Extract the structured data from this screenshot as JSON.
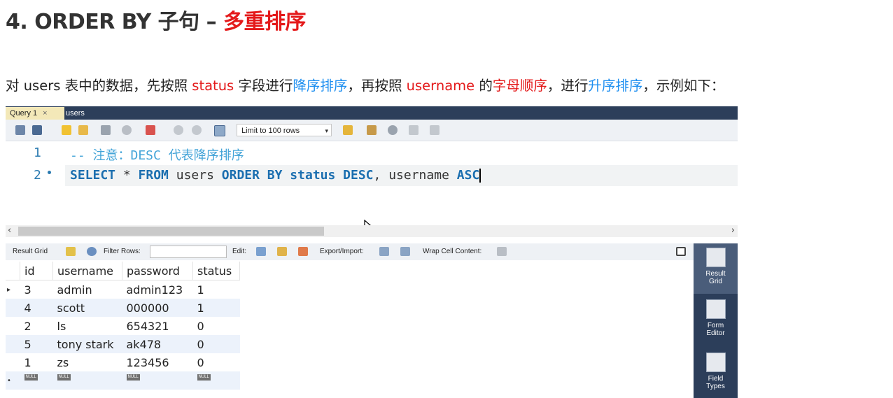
{
  "heading": {
    "prefix": "4. ORDER BY 子句 – ",
    "highlight": "多重排序"
  },
  "intro": {
    "p1": "对 users 表中的数据，先按照 ",
    "status": "status",
    "p2": " 字段进行",
    "desc": "降序排序",
    "p3": "，再按照 ",
    "username": "username",
    "p4": " 的",
    "alpha": "字母顺序",
    "p5": "，进行",
    "asc": "升序排序",
    "p6": "，示例如下："
  },
  "tabs": {
    "active": "Query 1",
    "close": "×",
    "other": "users"
  },
  "toolbar": {
    "limit_label": "Limit to 100 rows",
    "limit_arrow": "▾"
  },
  "editor": {
    "line1_no": "1",
    "line2_no": "2",
    "line1": "-- 注意：DESC 代表降序排序",
    "kw_select": "SELECT",
    "star": " * ",
    "kw_from": "FROM",
    "t_users": " users ",
    "kw_order": "ORDER BY",
    "t_status": " status ",
    "kw_desc": "DESC",
    "t_username": ", username ",
    "kw_asc": "ASC"
  },
  "hscroll": {
    "left": "‹",
    "right": "›"
  },
  "result_toolbar": {
    "result_grid": "Result Grid",
    "filter_rows": "Filter Rows:",
    "edit": "Edit:",
    "export_import": "Export/Import:",
    "wrap": "Wrap Cell Content:"
  },
  "grid": {
    "columns": [
      "id",
      "username",
      "password",
      "status"
    ],
    "rows": [
      [
        "3",
        "admin",
        "admin123",
        "1"
      ],
      [
        "4",
        "scott",
        "000000",
        "1"
      ],
      [
        "2",
        "ls",
        "654321",
        "0"
      ],
      [
        "5",
        "tony stark",
        "ak478",
        "0"
      ],
      [
        "1",
        "zs",
        "123456",
        "0"
      ]
    ],
    "null_label": "NULL",
    "current_row_marker": "▸",
    "new_row_marker": "•"
  },
  "sidepanel": [
    {
      "line1": "Result",
      "line2": "Grid"
    },
    {
      "line1": "Form",
      "line2": "Editor"
    },
    {
      "line1": "Field",
      "line2": "Types"
    }
  ]
}
